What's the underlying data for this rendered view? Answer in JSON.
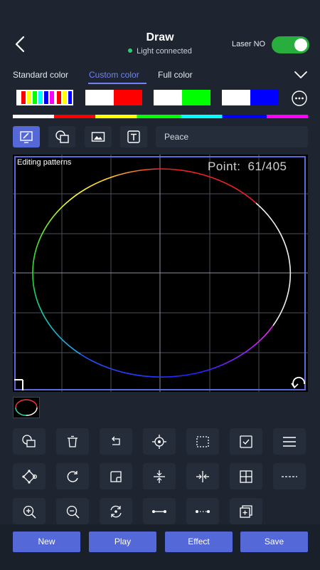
{
  "header": {
    "title": "Draw",
    "status": "Light connected",
    "laser_label": "Laser NO",
    "laser_on": true
  },
  "color_tabs": {
    "items": [
      "Standard color",
      "Custom color",
      "Full color"
    ],
    "selected": "Custom color"
  },
  "swatches": [
    {
      "colors": [
        "#ff0000",
        "#ffff00",
        "#00ff00",
        "#00ffff",
        "#0000ff",
        "#ff00ff"
      ],
      "selected": true
    },
    {
      "colors": [
        "#ff0000"
      ],
      "selected": false
    },
    {
      "colors": [
        "#00ff00"
      ],
      "selected": false
    },
    {
      "colors": [
        "#0000ff"
      ],
      "selected": false
    }
  ],
  "tools": {
    "items": [
      "draw-tool",
      "shape-tool",
      "image-tool",
      "text-tool"
    ],
    "selected": "draw-tool",
    "text_value": "Peace"
  },
  "canvas": {
    "label": "Editing patterns",
    "point_label": "Point:",
    "point_value": "61/405"
  },
  "grid_buttons": [
    {
      "icon": "shapes-icon"
    },
    {
      "icon": "trash-icon"
    },
    {
      "icon": "undo-icon"
    },
    {
      "icon": "target-icon"
    },
    {
      "icon": "select-rect-icon"
    },
    {
      "icon": "checkbox-icon"
    },
    {
      "icon": "menu-icon"
    },
    {
      "icon": "node-edit-icon"
    },
    {
      "icon": "rotate-icon"
    },
    {
      "icon": "corner-round-icon"
    },
    {
      "icon": "compress-vertical-icon"
    },
    {
      "icon": "compress-horizontal-icon"
    },
    {
      "icon": "expand-icon"
    },
    {
      "icon": "dashed-line-icon"
    },
    {
      "icon": "zoom-in-icon"
    },
    {
      "icon": "zoom-out-icon"
    },
    {
      "icon": "refresh-icon"
    },
    {
      "icon": "line-icon"
    },
    {
      "icon": "dotted-line-icon"
    },
    {
      "icon": "layers-add-icon"
    }
  ],
  "bottom": {
    "new": "New",
    "play": "Play",
    "effect": "Effect",
    "save": "Save"
  }
}
